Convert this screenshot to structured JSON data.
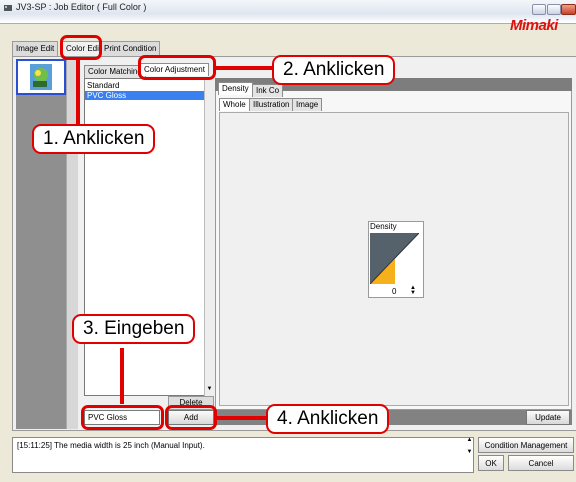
{
  "window": {
    "title": "JV3-SP : Job Editor ( Full Color )",
    "logo": "Mimaki"
  },
  "main_tabs": [
    "Image Edit",
    "Color Edit",
    "Print Condition"
  ],
  "sub_tabs": [
    "Color Matching",
    "Color Adjustment"
  ],
  "condition_list": {
    "items": [
      "Standard",
      "PVC Gloss"
    ],
    "selected_index": 1
  },
  "name_input": {
    "value": "PVC Gloss"
  },
  "buttons": {
    "delete": "Delete",
    "add": "Add",
    "update": "Update",
    "condition_management": "Condition Management",
    "ok": "OK",
    "cancel": "Cancel"
  },
  "adjust_tabs": [
    "Density",
    "Ink Co",
    "Whole",
    "Illustration",
    "Image"
  ],
  "density": {
    "label": "Density",
    "value": "0"
  },
  "log": {
    "text": "[15:11:25] The media width is 25 inch (Manual Input)."
  },
  "callouts": {
    "step1": "1. Anklicken",
    "step2": "2. Anklicken",
    "step3": "3. Eingeben",
    "step4": "4. Anklicken"
  },
  "colors": {
    "callout_red": "#e00000",
    "selection_blue": "#3a80f0",
    "graph_dark": "#55616b",
    "graph_yellow": "#f5b01c"
  }
}
